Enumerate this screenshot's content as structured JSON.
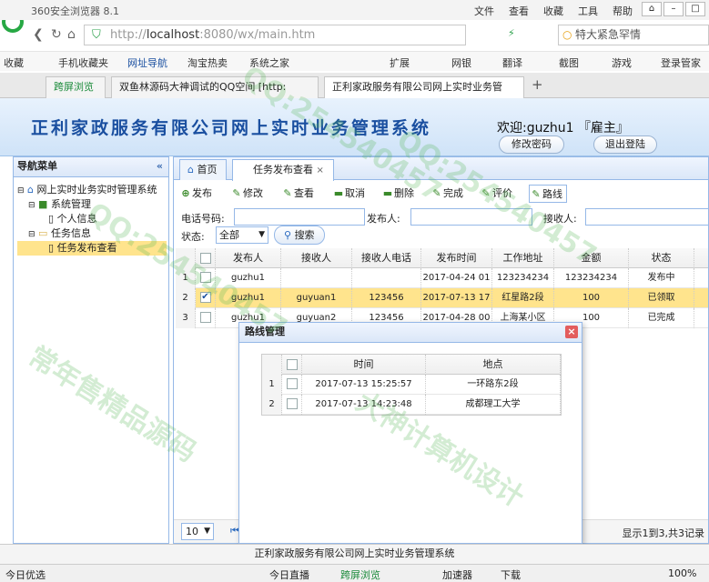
{
  "browser": {
    "title": "360安全浏览器 8.1",
    "menus": [
      "文件",
      "查看",
      "收藏",
      "工具",
      "帮助"
    ],
    "url_prefix": "http://",
    "url_host": "localhost",
    "url_rest": ":8080/wx/main.htm",
    "search_text": "特大紧急罕情",
    "favorites": [
      "收藏",
      "手机收藏夹",
      "网址导航",
      "淘宝热卖",
      "系统之家",
      "扩展",
      "网银",
      "翻译",
      "截图",
      "游戏",
      "登录管家"
    ],
    "tabs": [
      "跨屏浏览",
      "双鱼林源码大神调试的QQ空间 [http:",
      "正利家政服务有限公司网上实时业务管"
    ]
  },
  "app": {
    "title": "正利家政服务有限公司网上实时业务管理系统",
    "welcome": "欢迎:guzhu1 『雇主』",
    "change_password": "修改密码",
    "logout": "退出登陆"
  },
  "nav": {
    "title": "导航菜单",
    "collapse": "«",
    "root": "网上实时业务实时管理系统",
    "nodes": [
      {
        "label": "系统管理",
        "children": [
          "个人信息"
        ]
      },
      {
        "label": "任务信息",
        "children": [
          "任务发布查看"
        ]
      }
    ]
  },
  "main": {
    "tabs": [
      "首页",
      "任务发布查看"
    ],
    "toolbar": [
      "发布",
      "修改",
      "查看",
      "取消",
      "删除",
      "完成",
      "评价",
      "路线"
    ],
    "filters": {
      "phone_label": "电话号码:",
      "publisher_label": "发布人:",
      "receiver_label": "接收人:",
      "state_label": "状态:",
      "state_value": "全部",
      "search": "搜索"
    },
    "columns": [
      "发布人",
      "接收人",
      "接收人电话",
      "发布时间",
      "工作地址",
      "金额",
      "状态"
    ],
    "rows": [
      {
        "n": "1",
        "checked": false,
        "publisher": "guzhu1",
        "receiver": "",
        "phone": "",
        "time": "2017-04-24 01",
        "address": "123234234",
        "amount": "123234234",
        "state": "发布中"
      },
      {
        "n": "2",
        "checked": true,
        "publisher": "guzhu1",
        "receiver": "guyuan1",
        "phone": "123456",
        "time": "2017-07-13 17",
        "address": "红星路2段",
        "amount": "100",
        "state": "已领取"
      },
      {
        "n": "3",
        "checked": false,
        "publisher": "guzhu1",
        "receiver": "guyuan2",
        "phone": "123456",
        "time": "2017-04-28 00",
        "address": "上海某小区",
        "amount": "100",
        "state": "已完成"
      }
    ],
    "page_size": "10",
    "pager_info": "显示1到3,共3记录"
  },
  "route_dialog": {
    "title": "路线管理",
    "close": "×",
    "columns": [
      "时间",
      "地点"
    ],
    "rows": [
      {
        "n": "1",
        "time": "2017-07-13 15:25:57",
        "place": "一环路东2段"
      },
      {
        "n": "2",
        "time": "2017-07-13 14:23:48",
        "place": "成都理工大学"
      }
    ]
  },
  "footer": "正利家政服务有限公司网上实时业务管理系统",
  "statusbar": {
    "left": "今日优选",
    "items": [
      "今日直播",
      "跨屏浏览",
      "加速器",
      "下载"
    ],
    "zoom": "100%"
  },
  "watermarks": [
    "常年售精品源码",
    "QQ:254540457",
    "大神计算机设计"
  ]
}
